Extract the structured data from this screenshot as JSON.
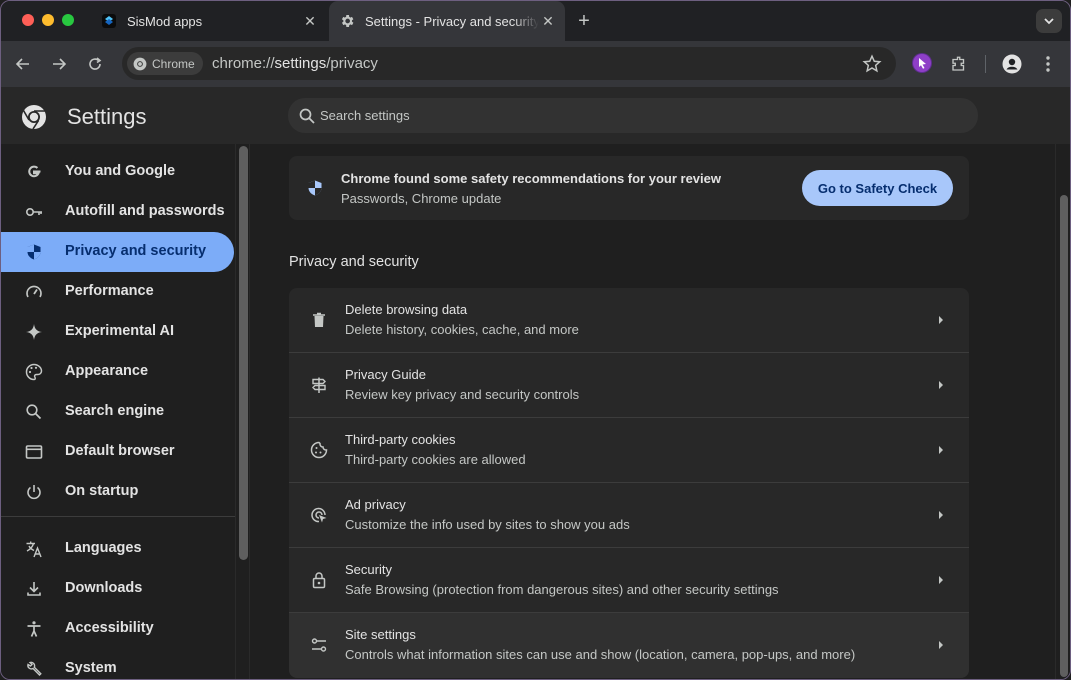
{
  "browser": {
    "tabs": [
      {
        "title": "SisMod apps"
      },
      {
        "title": "Settings - Privacy and security"
      }
    ],
    "omnibox": {
      "chip_label": "Chrome",
      "url_prefix": "chrome://",
      "url_main": "settings",
      "url_rest": "/privacy"
    }
  },
  "header": {
    "title": "Settings",
    "search_placeholder": "Search settings"
  },
  "sidebar": {
    "items": [
      {
        "label": "You and Google",
        "icon": "google-g-icon"
      },
      {
        "label": "Autofill and passwords",
        "icon": "key-icon"
      },
      {
        "label": "Privacy and security",
        "icon": "shield-icon",
        "active": true
      },
      {
        "label": "Performance",
        "icon": "speedometer-icon"
      },
      {
        "label": "Experimental AI",
        "icon": "sparkle-icon"
      },
      {
        "label": "Appearance",
        "icon": "palette-icon"
      },
      {
        "label": "Search engine",
        "icon": "search-icon"
      },
      {
        "label": "Default browser",
        "icon": "browser-window-icon"
      },
      {
        "label": "On startup",
        "icon": "power-icon"
      },
      {
        "label": "Languages",
        "icon": "translate-icon"
      },
      {
        "label": "Downloads",
        "icon": "download-icon"
      },
      {
        "label": "Accessibility",
        "icon": "accessibility-icon"
      },
      {
        "label": "System",
        "icon": "wrench-icon"
      }
    ]
  },
  "safety_banner": {
    "title": "Chrome found some safety recommendations for your review",
    "subtitle": "Passwords, Chrome update",
    "button_label": "Go to Safety Check"
  },
  "privacy_section": {
    "title": "Privacy and security",
    "rows": [
      {
        "title": "Delete browsing data",
        "subtitle": "Delete history, cookies, cache, and more",
        "icon": "trash-icon"
      },
      {
        "title": "Privacy Guide",
        "subtitle": "Review key privacy and security controls",
        "icon": "signpost-icon"
      },
      {
        "title": "Third-party cookies",
        "subtitle": "Third-party cookies are allowed",
        "icon": "cookie-icon"
      },
      {
        "title": "Ad privacy",
        "subtitle": "Customize the info used by sites to show you ads",
        "icon": "ad-target-icon"
      },
      {
        "title": "Security",
        "subtitle": "Safe Browsing (protection from dangerous sites) and other security settings",
        "icon": "lock-icon"
      },
      {
        "title": "Site settings",
        "subtitle": "Controls what information sites can use and show (location, camera, pop-ups, and more)",
        "icon": "sliders-icon"
      }
    ]
  },
  "colors": {
    "accent": "#7cacf8",
    "button_bg": "#a8c7fa",
    "background": "#1f1f1f",
    "card": "#282828"
  }
}
